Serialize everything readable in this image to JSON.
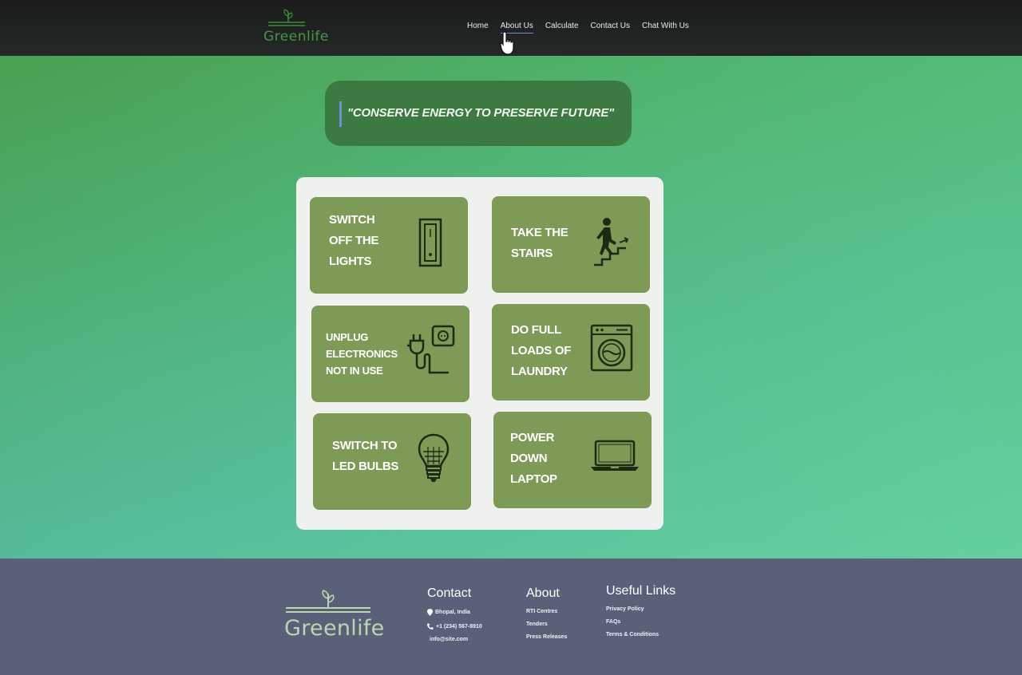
{
  "nav": {
    "logo_text": "Greenlife",
    "links": [
      "Home",
      "About Us",
      "Calculate",
      "Contact Us",
      "Chat With Us"
    ],
    "active_index": 1
  },
  "hero": {
    "quote": "\"CONSERVE ENERGY TO PRESERVE FUTURE\""
  },
  "tips": [
    {
      "label": "SWITCH\nOFF THE\nLIGHTS",
      "icon": "light-switch-icon"
    },
    {
      "label": "TAKE THE\nSTAIRS",
      "icon": "stairs-icon"
    },
    {
      "label": "UNPLUG\nELECTRONICS\nNOT IN USE",
      "icon": "plug-socket-icon"
    },
    {
      "label": "DO FULL\nLOADS OF\nLAUNDRY",
      "icon": "washing-machine-icon"
    },
    {
      "label": "SWITCH TO\nLED BULBS",
      "icon": "led-bulb-icon"
    },
    {
      "label": "POWER\nDOWN\nLAPTOP",
      "icon": "laptop-icon"
    }
  ],
  "footer": {
    "logo_text": "Greenlife",
    "contact": {
      "heading": "Contact",
      "location": "Bhopal, India",
      "phone": "+1 (234) 567-8910",
      "email": "info@site.com"
    },
    "about": {
      "heading": "About",
      "links": [
        "RTI Centres",
        "Tenders",
        "Press Releases"
      ]
    },
    "useful": {
      "heading": "Useful Links",
      "links": [
        "Privacy Policy",
        "FAQs",
        "Terms & Conditions"
      ]
    }
  },
  "colors": {
    "navbar": "#1f2221",
    "quote_box": "#3d7a41",
    "card": "#7e9a57",
    "panel": "#eef1ee",
    "footer": "#5a6078",
    "active_underline": "#6b87d8"
  }
}
